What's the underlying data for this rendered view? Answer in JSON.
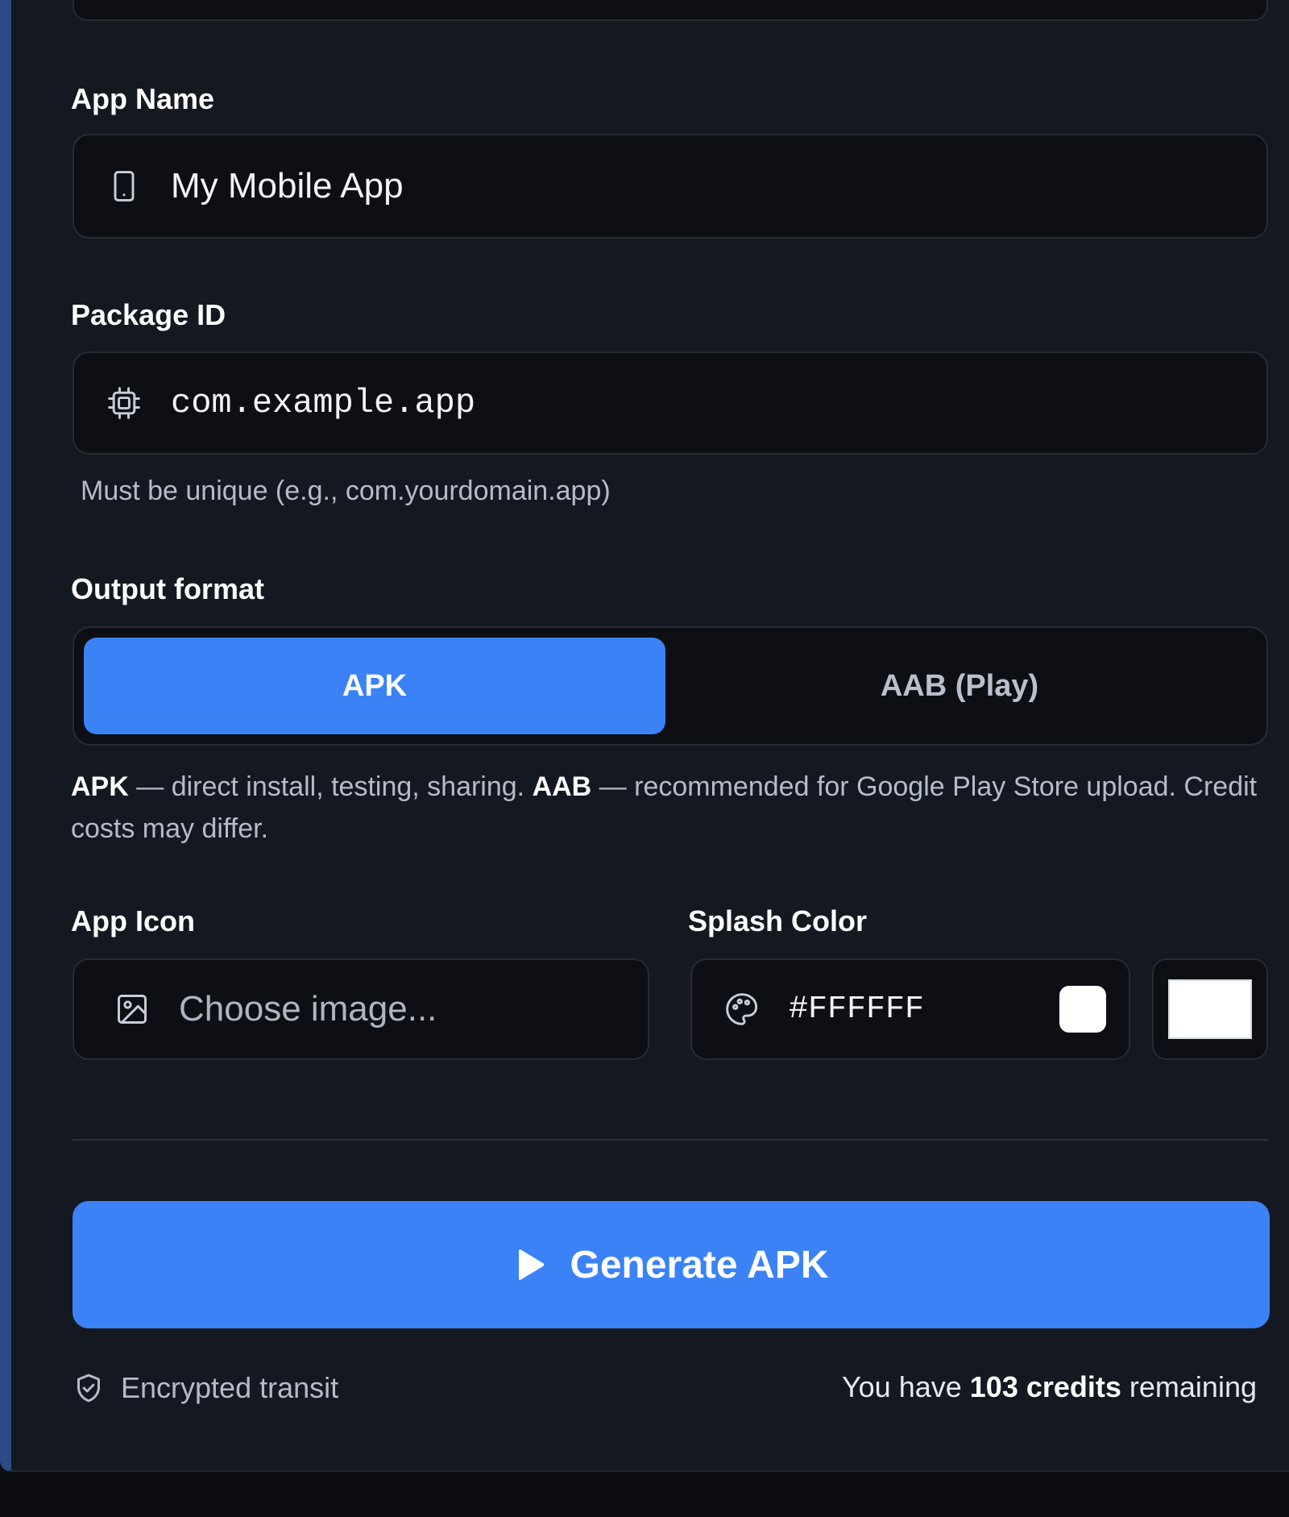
{
  "form": {
    "app_name": {
      "label": "App Name",
      "value": "My Mobile App",
      "icon": "smartphone-icon"
    },
    "package_id": {
      "label": "Package ID",
      "value": "com.example.app",
      "icon": "chip-icon",
      "hint": "Must be unique (e.g., com.yourdomain.app)"
    },
    "output_format": {
      "label": "Output format",
      "options": [
        "APK",
        "AAB (Play)"
      ],
      "selected": "APK",
      "description": {
        "apk_term": "APK",
        "apk_text": " — direct install, testing, sharing. ",
        "aab_term": "AAB",
        "aab_text": " — recommended for Google Play Store upload. Credit costs may differ."
      }
    },
    "app_icon": {
      "label": "App Icon",
      "placeholder": "Choose image...",
      "icon": "image-icon"
    },
    "splash_color": {
      "label": "Splash Color",
      "value": "#FFFFFF",
      "icon": "palette-icon",
      "swatch": "#FFFFFF"
    }
  },
  "actions": {
    "generate_label": "Generate APK",
    "icon": "play-icon",
    "accent": "#3B82F6"
  },
  "footer": {
    "security_text": "Encrypted transit",
    "security_icon": "shield-icon",
    "credits_prefix": "You have ",
    "credits_bold": "103 credits",
    "credits_suffix": " remaining"
  }
}
